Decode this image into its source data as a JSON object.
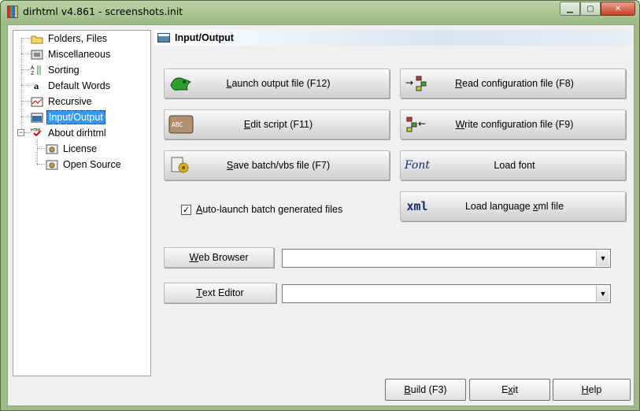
{
  "window": {
    "title": "dirhtml v4.861 - screenshots.init",
    "minimize_glyph": "▁",
    "maximize_glyph": "▢",
    "close_glyph": "✕"
  },
  "tree": {
    "items": [
      {
        "label": "Folders, Files",
        "icon": "folder-icon"
      },
      {
        "label": "Miscellaneous",
        "icon": "misc-icon"
      },
      {
        "label": "Sorting",
        "icon": "sort-icon"
      },
      {
        "label": "Default Words",
        "icon": "words-icon"
      },
      {
        "label": "Recursive",
        "icon": "recursive-icon"
      },
      {
        "label": "Input/Output",
        "icon": "input-output-icon",
        "selected": true
      },
      {
        "label": "About dirhtml",
        "icon": "html-icon"
      },
      {
        "label": "License",
        "icon": "license-icon"
      },
      {
        "label": "Open Source",
        "icon": "open-source-icon"
      }
    ],
    "expander_glyph": "−"
  },
  "panel": {
    "title": "Input/Output"
  },
  "buttons": {
    "launch": {
      "pre": "",
      "u": "L",
      "post": "aunch output file (F12)"
    },
    "read_config": {
      "pre": "",
      "u": "R",
      "post": "ead configuration file (F8)"
    },
    "edit_script": {
      "pre": "",
      "u": "E",
      "post": "dit script (F11)"
    },
    "write_config": {
      "pre": "",
      "u": "W",
      "post": "rite configuration file (F9)"
    },
    "save_batch": {
      "pre": "",
      "u": "S",
      "post": "ave batch/vbs file (F7)"
    },
    "load_font": {
      "pre": "Load font",
      "u": "",
      "post": ""
    },
    "load_language": {
      "pre": "Load language ",
      "u": "x",
      "post": "ml file"
    }
  },
  "icons": {
    "edit_script_text": "ABC",
    "font_text": "Font",
    "xml_text": "xml",
    "read_config_glyph": "→",
    "write_config_glyph": "←"
  },
  "checkbox": {
    "checked": true,
    "glyph": "✓",
    "label_u": "A",
    "label_post": "uto-launch batch generated files"
  },
  "web_browser": {
    "label_u": "W",
    "label_post": "eb Browser",
    "value": ""
  },
  "text_editor": {
    "label_u": "T",
    "label_post": "ext Editor",
    "value": ""
  },
  "combo_arrow_glyph": "▼",
  "footer": {
    "build": {
      "u": "B",
      "post": "uild (F3)"
    },
    "exit": {
      "pre": "E",
      "u": "x",
      "post": "it"
    },
    "help": {
      "u": "H",
      "post": "elp"
    }
  },
  "colors": {
    "selection": "#3399ff",
    "title_bar": "#9dbb83",
    "header_gradient_end": "#d8e4f0"
  }
}
